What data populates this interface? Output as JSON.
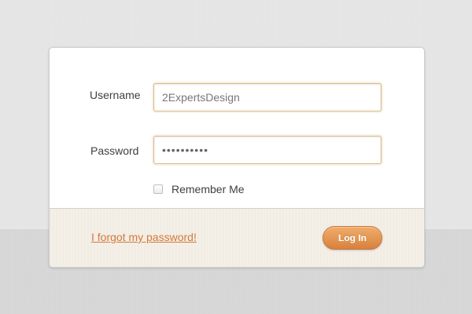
{
  "form": {
    "username_label": "Username",
    "username_value": "2ExpertsDesign",
    "password_label": "Password",
    "password_value": "••••••••••",
    "remember_label": "Remember Me",
    "remember_checked": false,
    "forgot_link": "I forgot my password!",
    "login_button": "Log In"
  },
  "colors": {
    "accent": "#d4793a",
    "button": "#e59854",
    "field_border": "#d9b98a",
    "footer_bg": "#f4efe7"
  }
}
